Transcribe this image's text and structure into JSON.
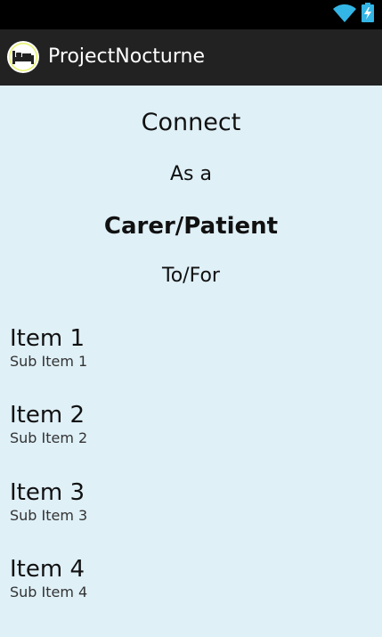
{
  "status_bar": {
    "icons": [
      "wifi-icon",
      "battery-charging-icon"
    ],
    "background": "#000000",
    "accent": "#33b5e5"
  },
  "action_bar": {
    "app_icon": "bed-icon",
    "title": "ProjectNocturne",
    "background": "#222222"
  },
  "main": {
    "connect": "Connect",
    "as_a": "As a",
    "role": "Carer/Patient",
    "to_for": "To/For",
    "background": "#dff0f7",
    "items": [
      {
        "title": "Item 1",
        "subtitle": "Sub Item 1"
      },
      {
        "title": "Item 2",
        "subtitle": "Sub Item 2"
      },
      {
        "title": "Item 3",
        "subtitle": "Sub Item 3"
      },
      {
        "title": "Item 4",
        "subtitle": "Sub Item 4"
      }
    ]
  }
}
